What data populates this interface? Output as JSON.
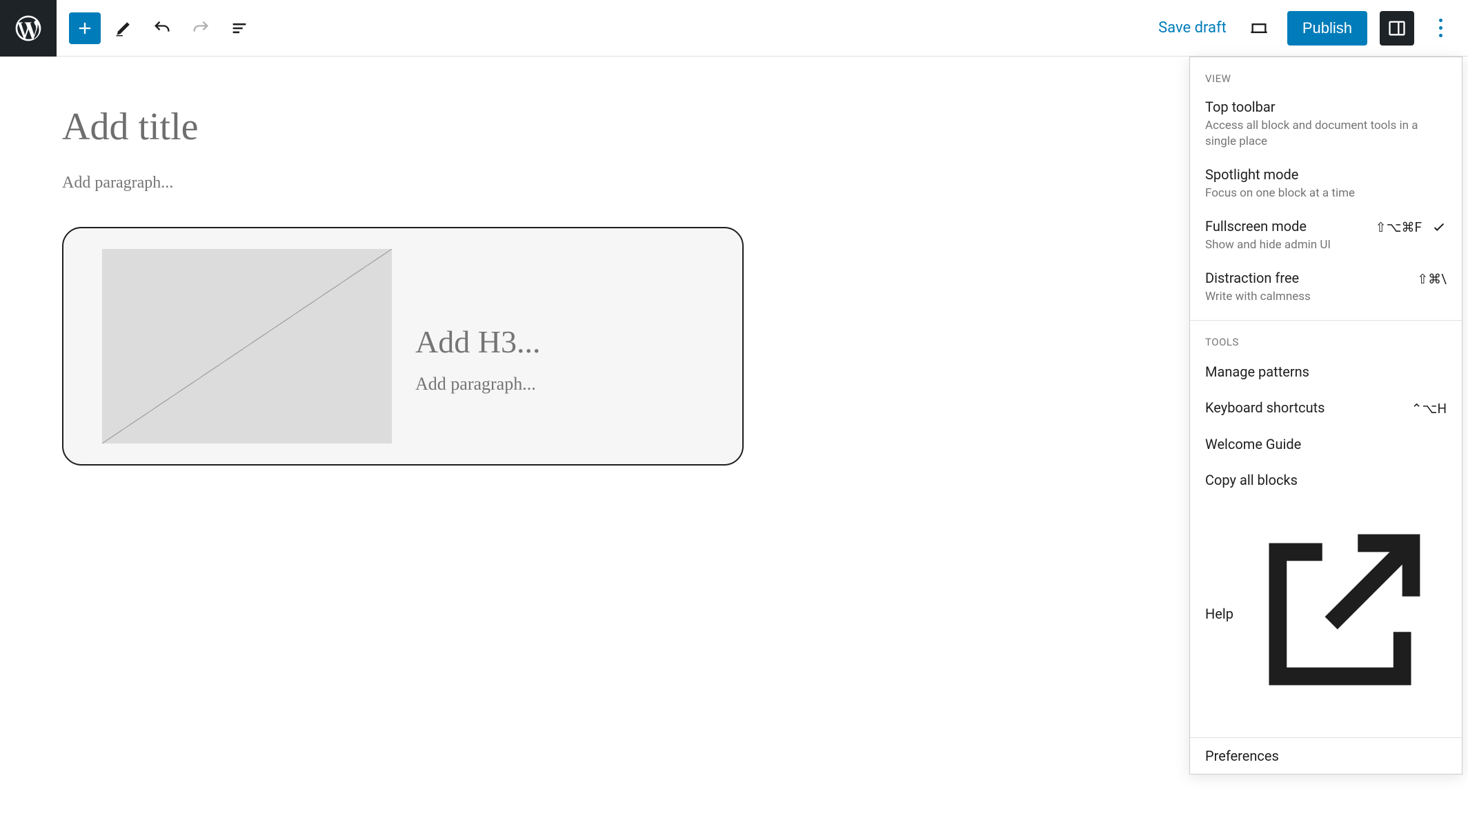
{
  "topbar": {
    "save_draft": "Save draft",
    "publish": "Publish"
  },
  "canvas": {
    "title_placeholder": "Add title",
    "paragraph_placeholder": "Add paragraph...",
    "h3_placeholder": "Add H3...",
    "inner_paragraph_placeholder": "Add paragraph..."
  },
  "menu": {
    "section_view": "VIEW",
    "section_tools": "TOOLS",
    "view": [
      {
        "title": "Top toolbar",
        "desc": "Access all block and document tools in a single place",
        "shortcut": "",
        "checked": false
      },
      {
        "title": "Spotlight mode",
        "desc": "Focus on one block at a time",
        "shortcut": "",
        "checked": false
      },
      {
        "title": "Fullscreen mode",
        "desc": "Show and hide admin UI",
        "shortcut": "⇧⌥⌘F",
        "checked": true
      },
      {
        "title": "Distraction free",
        "desc": "Write with calmness",
        "shortcut": "⇧⌘\\",
        "checked": false
      }
    ],
    "tools": [
      {
        "title": "Manage patterns",
        "shortcut": "",
        "external": false
      },
      {
        "title": "Keyboard shortcuts",
        "shortcut": "⌃⌥H",
        "external": false
      },
      {
        "title": "Welcome Guide",
        "shortcut": "",
        "external": false
      },
      {
        "title": "Copy all blocks",
        "shortcut": "",
        "external": false
      },
      {
        "title": "Help",
        "shortcut": "",
        "external": true
      }
    ],
    "preferences": "Preferences"
  }
}
